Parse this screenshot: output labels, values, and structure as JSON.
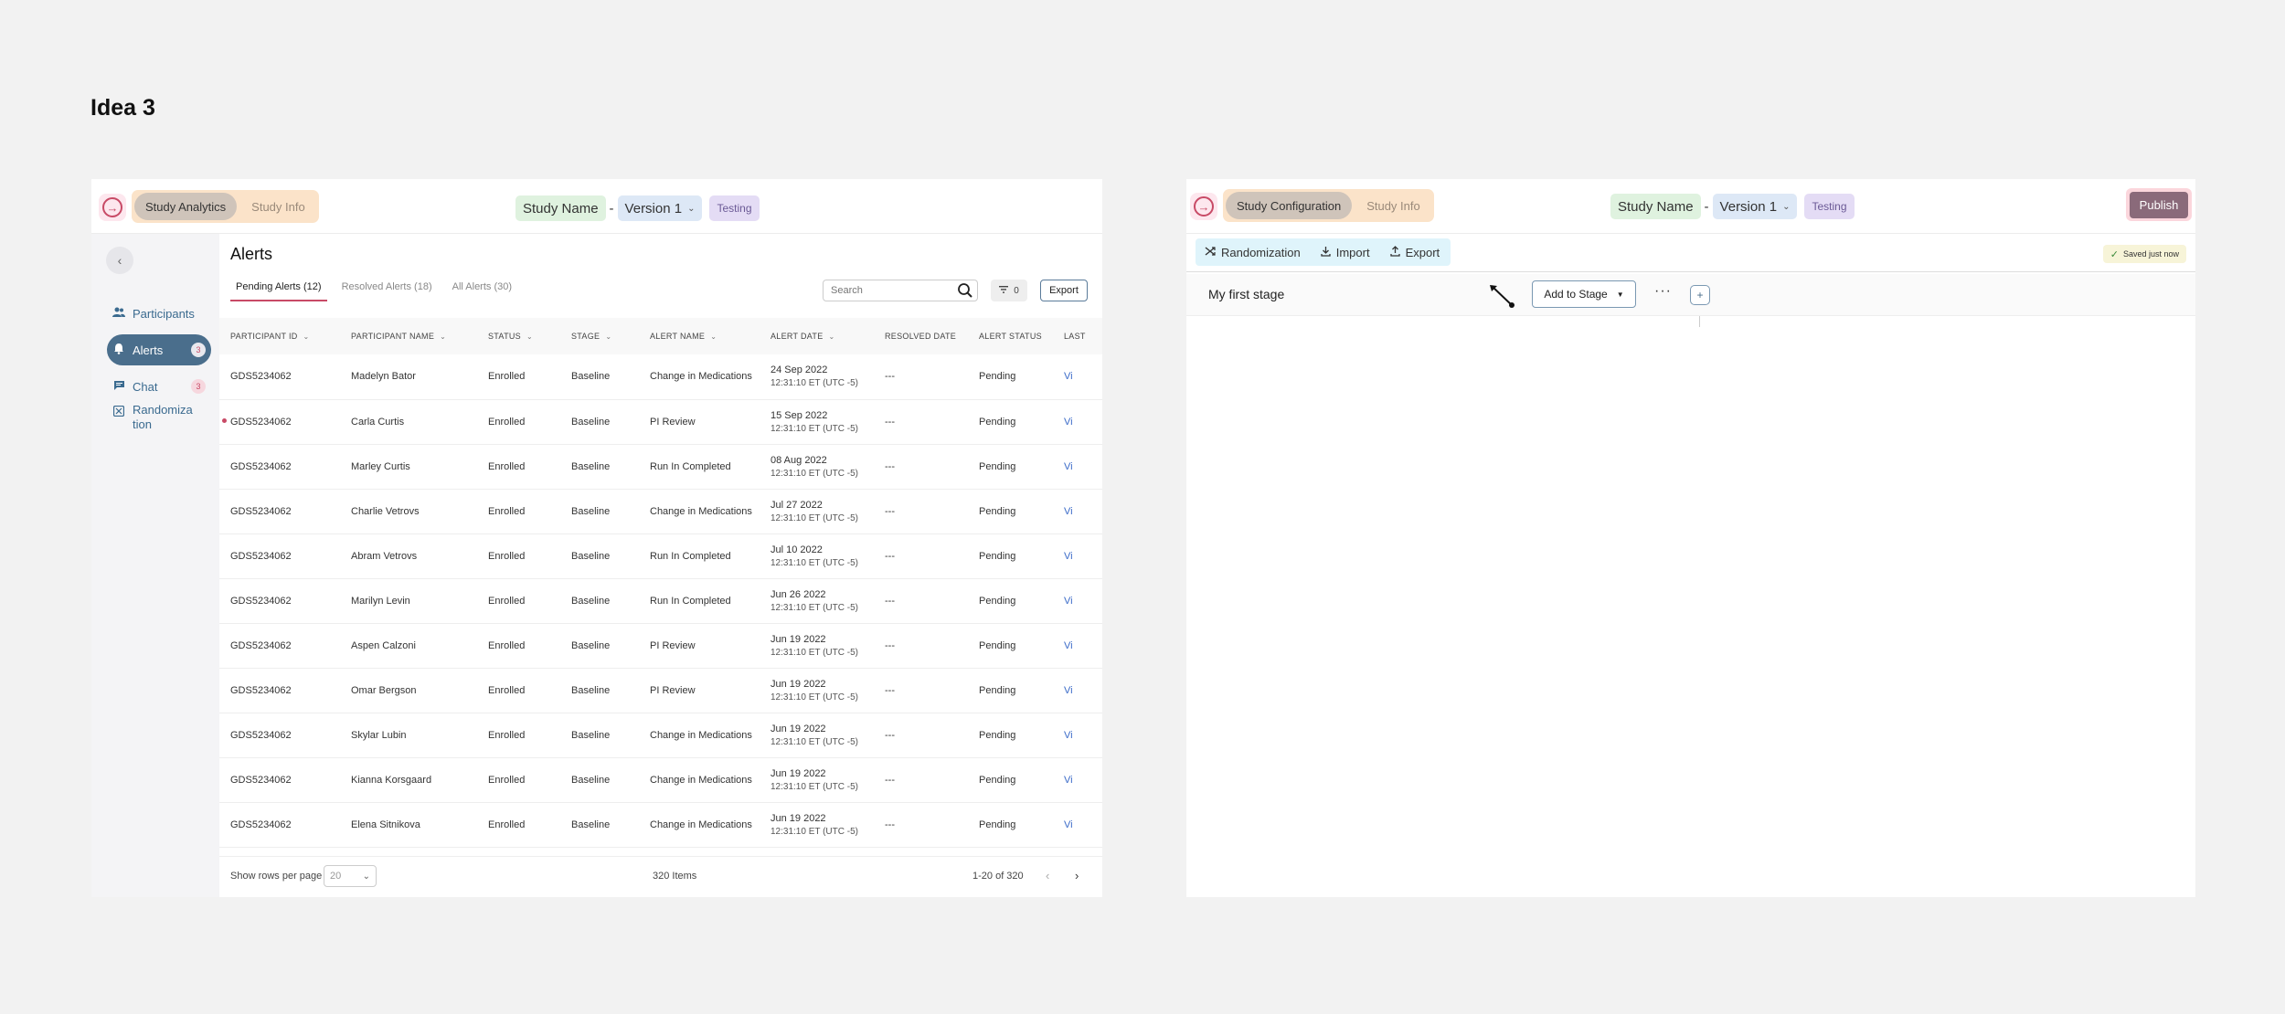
{
  "page_title": "Idea 3",
  "left": {
    "header": {
      "seg_active": "Study Analytics",
      "seg_inactive": "Study Info",
      "study_name": "Study Name",
      "dash": "-",
      "version": "Version 1",
      "status": "Testing"
    },
    "sidebar": {
      "items": [
        {
          "label": "Participants",
          "icon": "participants-icon"
        },
        {
          "label": "Alerts",
          "badge": "3",
          "icon": "bell-icon"
        },
        {
          "label": "Chat",
          "badge": "3",
          "icon": "chat-icon"
        },
        {
          "label": "Randomiza\ntion",
          "icon": "randomization-icon"
        }
      ]
    },
    "alerts": {
      "title": "Alerts",
      "tabs": [
        "Pending Alerts (12)",
        "Resolved Alerts (18)",
        "All Alerts (30)"
      ],
      "search_placeholder": "Search",
      "filter_count": "0",
      "export_label": "Export",
      "columns": [
        "PARTICIPANT ID",
        "PARTICIPANT NAME",
        "STATUS",
        "STAGE",
        "ALERT NAME",
        "ALERT DATE",
        "RESOLVED DATE",
        "ALERT STATUS",
        "LAST"
      ],
      "rows": [
        {
          "id": "GDS5234062",
          "name": "Madelyn Bator",
          "status": "Enrolled",
          "stage": "Baseline",
          "alert": "Change in Medications",
          "date": "24 Sep 2022",
          "time": "12:31:10 ET (UTC -5)",
          "resolved": "---",
          "alert_status": "Pending",
          "link": "Vi",
          "dot": false
        },
        {
          "id": "GDS5234062",
          "name": "Carla Curtis",
          "status": "Enrolled",
          "stage": "Baseline",
          "alert": "PI Review",
          "date": "15 Sep 2022",
          "time": "12:31:10 ET (UTC -5)",
          "resolved": "---",
          "alert_status": "Pending",
          "link": "Vi",
          "dot": true
        },
        {
          "id": "GDS5234062",
          "name": "Marley Curtis",
          "status": "Enrolled",
          "stage": "Baseline",
          "alert": "Run In Completed",
          "date": "08 Aug 2022",
          "time": "12:31:10 ET (UTC -5)",
          "resolved": "---",
          "alert_status": "Pending",
          "link": "Vi",
          "dot": false
        },
        {
          "id": "GDS5234062",
          "name": "Charlie Vetrovs",
          "status": "Enrolled",
          "stage": "Baseline",
          "alert": "Change in Medications",
          "date": "Jul 27 2022",
          "time": "12:31:10 ET (UTC -5)",
          "resolved": "---",
          "alert_status": "Pending",
          "link": "Vi",
          "dot": false
        },
        {
          "id": "GDS5234062",
          "name": "Abram Vetrovs",
          "status": "Enrolled",
          "stage": "Baseline",
          "alert": "Run In Completed",
          "date": "Jul 10 2022",
          "time": "12:31:10 ET (UTC -5)",
          "resolved": "---",
          "alert_status": "Pending",
          "link": "Vi",
          "dot": false
        },
        {
          "id": "GDS5234062",
          "name": "Marilyn Levin",
          "status": "Enrolled",
          "stage": "Baseline",
          "alert": "Run In Completed",
          "date": "Jun 26 2022",
          "time": "12:31:10 ET (UTC -5)",
          "resolved": "---",
          "alert_status": "Pending",
          "link": "Vi",
          "dot": false
        },
        {
          "id": "GDS5234062",
          "name": "Aspen Calzoni",
          "status": "Enrolled",
          "stage": "Baseline",
          "alert": "PI Review",
          "date": "Jun 19 2022",
          "time": "12:31:10 ET (UTC -5)",
          "resolved": "---",
          "alert_status": "Pending",
          "link": "Vi",
          "dot": false
        },
        {
          "id": "GDS5234062",
          "name": "Omar Bergson",
          "status": "Enrolled",
          "stage": "Baseline",
          "alert": "PI Review",
          "date": "Jun 19 2022",
          "time": "12:31:10 ET (UTC -5)",
          "resolved": "---",
          "alert_status": "Pending",
          "link": "Vi",
          "dot": false
        },
        {
          "id": "GDS5234062",
          "name": "Skylar Lubin",
          "status": "Enrolled",
          "stage": "Baseline",
          "alert": "Change in Medications",
          "date": "Jun 19 2022",
          "time": "12:31:10 ET (UTC -5)",
          "resolved": "---",
          "alert_status": "Pending",
          "link": "Vi",
          "dot": false
        },
        {
          "id": "GDS5234062",
          "name": "Kianna Korsgaard",
          "status": "Enrolled",
          "stage": "Baseline",
          "alert": "Change in Medications",
          "date": "Jun 19 2022",
          "time": "12:31:10 ET (UTC -5)",
          "resolved": "---",
          "alert_status": "Pending",
          "link": "Vi",
          "dot": false
        },
        {
          "id": "GDS5234062",
          "name": "Elena Sitnikova",
          "status": "Enrolled",
          "stage": "Baseline",
          "alert": "Change in Medications",
          "date": "Jun 19 2022",
          "time": "12:31:10 ET (UTC -5)",
          "resolved": "---",
          "alert_status": "Pending",
          "link": "Vi",
          "dot": false
        }
      ],
      "footer": {
        "rows_label": "Show rows per page",
        "rows_value": "20",
        "items": "320 Items",
        "range": "1-20 of 320"
      }
    }
  },
  "right": {
    "header": {
      "seg_active": "Study Configuration",
      "seg_inactive": "Study Info",
      "study_name": "Study Name",
      "dash": "-",
      "version": "Version 1",
      "status": "Testing",
      "publish": "Publish"
    },
    "toolbar": {
      "randomization": "Randomization",
      "import": "Import",
      "export": "Export",
      "saved": "Saved just now"
    },
    "stage": {
      "name": "My first stage",
      "add_label": "Add to Stage",
      "more": "···",
      "plus": "+"
    }
  },
  "colors": {
    "accent": "#c84a66",
    "nav_active": "#4a6e8c",
    "seg_bg": "#fbe3c9"
  }
}
